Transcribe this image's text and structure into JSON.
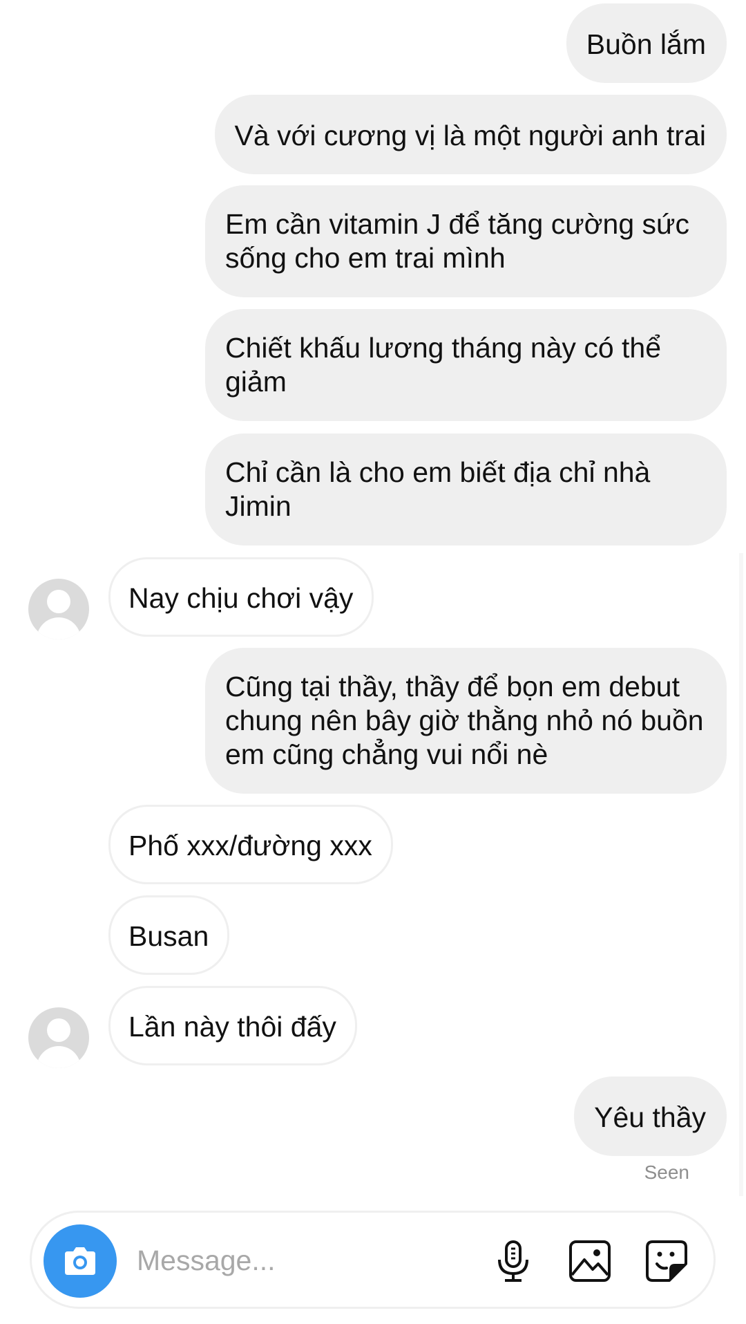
{
  "messages": [
    {
      "side": "out",
      "text": "Buồn lắm"
    },
    {
      "side": "out",
      "text": "Và với cương vị là một người anh trai"
    },
    {
      "side": "out",
      "text": "Em cần vitamin J để tăng cường sức sống cho em trai mình"
    },
    {
      "side": "out",
      "text": "Chiết khấu lương tháng này có thể giảm"
    },
    {
      "side": "out",
      "text": "Chỉ cần là cho em biết địa chỉ nhà Jimin"
    },
    {
      "side": "in",
      "text": "Nay chịu chơi vậy"
    },
    {
      "side": "out",
      "text": "Cũng tại thầy, thầy để bọn em debut chung nên bây giờ thằng nhỏ nó buồn em cũng chẳng vui nổi nè"
    },
    {
      "side": "in",
      "text": "Phố xxx/đường xxx"
    },
    {
      "side": "in",
      "text": "Busan"
    },
    {
      "side": "in",
      "text": "Lần này thôi đấy"
    },
    {
      "side": "out",
      "text": "Yêu thầy"
    }
  ],
  "status": {
    "seen_label": "Seen"
  },
  "composer": {
    "placeholder": "Message...",
    "icons": [
      "camera-icon",
      "microphone-icon",
      "gallery-icon",
      "sticker-icon"
    ]
  },
  "colors": {
    "outgoing_bubble": "#efefef",
    "incoming_border": "#efefef",
    "camera_button": "#3797f0",
    "seen_text": "#8e8e8e",
    "placeholder_text": "#a8a8a8"
  }
}
